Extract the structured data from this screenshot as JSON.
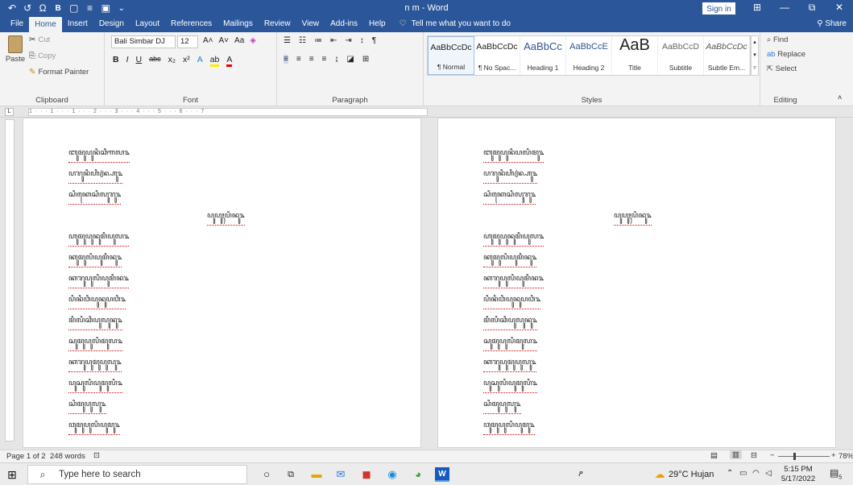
{
  "window": {
    "title": "n m - Word",
    "sign_in": "Sign in",
    "min": "—",
    "restore": "⧉",
    "close": "✕",
    "display_options": "⊞"
  },
  "quick_access": {
    "undo": "↶",
    "redo": "↺",
    "omega": "Ω",
    "b": "B",
    "new": "▢",
    "touch": "≡",
    "save": "▣",
    "more": "⌄"
  },
  "menu": {
    "tabs": [
      "File",
      "Home",
      "Insert",
      "Design",
      "Layout",
      "References",
      "Mailings",
      "Review",
      "View",
      "Add-ins",
      "Help"
    ],
    "tell_me": "Tell me what you want to do",
    "share": "Share"
  },
  "clipboard": {
    "paste": "Paste",
    "cut": "Cut",
    "copy": "Copy",
    "format_painter": "Format Painter",
    "label": "Clipboard"
  },
  "font": {
    "name": "Bali Simbar DJ",
    "size": "12",
    "label": "Font"
  },
  "paragraph": {
    "label": "Paragraph"
  },
  "styles": {
    "label": "Styles",
    "items": [
      {
        "sample": "AaBbCcDc",
        "name": "¶ Normal"
      },
      {
        "sample": "AaBbCcDc",
        "name": "¶ No Spac..."
      },
      {
        "sample": "AaBbCc",
        "name": "Heading 1"
      },
      {
        "sample": "AaBbCcE",
        "name": "Heading 2"
      },
      {
        "sample": "AaB",
        "name": "Title"
      },
      {
        "sample": "AaBbCcD",
        "name": "Subtitle"
      },
      {
        "sample": "AaBbCcDc",
        "name": "Subtle Em..."
      }
    ]
  },
  "editing": {
    "find": "Find",
    "replace": "Replace",
    "select": "Select",
    "label": "Editing"
  },
  "ruler": {
    "marks": "1 · · · 1 · · · 1 · · · 2 · · · 3 · · · 4 · · · 5 · · · 6 · · · 7"
  },
  "page_left": {
    "lines": [
      "ꦧꦸꦩꦸꦥꦸꦤꦶꦕꦶꦒꦭ꧉",
      "ꦥꦫꦸꦤꦶꦲꦶꦤ꧀ꦲꦿꦸ꧉",
      "ꦱꦶꦏꦺꦱꦶꦭꦸꦫꦸ꧉",
      "ꦥꦸꦥꦸꦃꦥꦶꦤꦸ꧉",
      "ꦲꦸꦩꦸꦥꦸꦤꦸꦩꦶꦥꦸꦭ꧉",
      "ꦏꦸꦩꦸꦭꦶꦥꦸꦩꦶꦤꦸ꧉",
      "ꦏꦫꦸꦥꦸꦭꦶꦥꦸꦩꦶꦤ꧉",
      "ꦥꦶꦤꦶꦮꦶꦥꦸꦤꦸꦥꦮꦶ꧉",
      "ꦩꦶꦭꦶꦕꦶꦥꦸꦭꦸꦤꦸ꧉",
      "ꦱꦸꦩꦸꦥꦸꦭꦶꦩꦸꦭ꧉",
      "ꦏꦫꦸꦥꦸꦩꦸꦥꦸꦭꦸ꧉",
      "ꦥꦸꦱꦸꦭꦶꦥꦸꦩꦸꦭꦶ꧉",
      "ꦱꦶꦩꦸꦥꦸꦭꦸ꧉",
      "ꦮꦸꦩꦸꦥꦸꦭꦶꦥꦸꦩꦸ꧉"
    ]
  },
  "page_right": {
    "lines": [
      "ꦧꦸꦩꦸꦥꦸꦤꦶꦥꦭꦶꦩꦸ꧉",
      "ꦥꦫꦸꦤꦶꦲꦶꦤ꧀ꦲꦿꦸ꧉",
      "ꦱꦶꦏꦺꦱꦶꦭꦸꦫꦸ꧉",
      "ꦥꦸꦥꦸꦃꦥꦶꦤꦸ꧉",
      "ꦲꦸꦩꦸꦥꦸꦤꦸꦩꦶꦥꦸꦭ꧉",
      "ꦏꦸꦩꦸꦭꦶꦥꦸꦩꦶꦤꦸ꧉",
      "ꦏꦫꦸꦥꦸꦭꦶꦥꦸꦩꦶꦤ꧉",
      "ꦥꦶꦤꦶꦮꦶꦥꦸꦤꦸꦥꦮꦶ꧉",
      "ꦩꦶꦭꦶꦕꦶꦥꦸꦭꦸꦤꦸ꧉",
      "ꦱꦸꦩꦸꦥꦸꦭꦶꦩꦸꦭ꧉",
      "ꦏꦫꦸꦥꦸꦩꦸꦥꦸꦭꦸ꧉",
      "ꦥꦸꦱꦸꦭꦶꦥꦸꦩꦸꦭꦶ꧉",
      "ꦱꦶꦩꦸꦥꦸꦭꦸ꧉",
      "ꦮꦸꦩꦸꦥꦸꦭꦶꦥꦸꦩꦸ꧉"
    ]
  },
  "status": {
    "page": "Page 1 of 2",
    "words": "248 words",
    "zoom": "78%",
    "zoom_minus": "−",
    "zoom_plus": "+"
  },
  "taskbar": {
    "search_placeholder": "Type here to search",
    "weather": "29°C Hujan",
    "time": "5:15 PM",
    "date": "5/17/2022",
    "notif_count": "5"
  },
  "colors": {
    "accent": "#2b579a",
    "word_blue": "#185abd"
  }
}
